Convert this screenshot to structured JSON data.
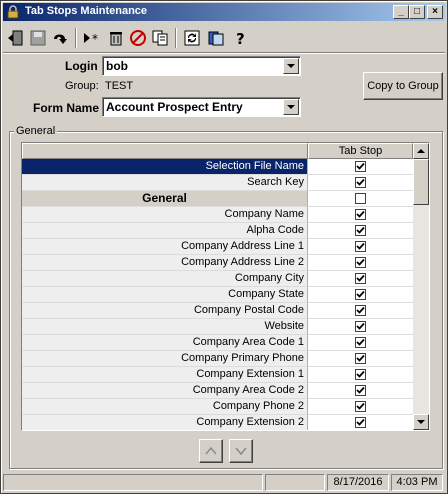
{
  "window": {
    "title": "Tab Stops Maintenance"
  },
  "toolbar": {
    "buttons": [
      {
        "name": "exit-icon"
      },
      {
        "name": "save-icon"
      },
      {
        "name": "undo-icon"
      },
      {
        "name": "new-record-icon"
      },
      {
        "name": "delete-icon"
      },
      {
        "name": "cancel-icon"
      },
      {
        "name": "copy-icon"
      },
      {
        "name": "refresh-icon"
      },
      {
        "name": "list-icon"
      },
      {
        "name": "help-icon"
      }
    ]
  },
  "form": {
    "login_label": "Login",
    "login_value": "bob",
    "group_label": "Group:",
    "group_value": "TEST",
    "form_name_label": "Form Name",
    "form_name_value": "Account Prospect Entry",
    "copy_button": "Copy to Group"
  },
  "general": {
    "group_label": "General",
    "column_header": "Tab Stop",
    "rows": [
      {
        "label": "Selection File Name",
        "checked": true,
        "selected": true,
        "section": false
      },
      {
        "label": "Search Key",
        "checked": true,
        "selected": false,
        "section": false
      },
      {
        "label": "General",
        "checked": false,
        "selected": false,
        "section": true
      },
      {
        "label": "Company Name",
        "checked": true,
        "selected": false,
        "section": false
      },
      {
        "label": "Alpha Code",
        "checked": true,
        "selected": false,
        "section": false
      },
      {
        "label": "Company Address Line 1",
        "checked": true,
        "selected": false,
        "section": false
      },
      {
        "label": "Company Address Line 2",
        "checked": true,
        "selected": false,
        "section": false
      },
      {
        "label": "Company City",
        "checked": true,
        "selected": false,
        "section": false
      },
      {
        "label": "Company State",
        "checked": true,
        "selected": false,
        "section": false
      },
      {
        "label": "Company Postal Code",
        "checked": true,
        "selected": false,
        "section": false
      },
      {
        "label": "Website",
        "checked": true,
        "selected": false,
        "section": false
      },
      {
        "label": "Company Area Code 1",
        "checked": true,
        "selected": false,
        "section": false
      },
      {
        "label": "Company Primary Phone",
        "checked": true,
        "selected": false,
        "section": false
      },
      {
        "label": "Company Extension 1",
        "checked": true,
        "selected": false,
        "section": false
      },
      {
        "label": "Company Area Code 2",
        "checked": true,
        "selected": false,
        "section": false
      },
      {
        "label": "Company Phone 2",
        "checked": true,
        "selected": false,
        "section": false
      },
      {
        "label": "Company Extension 2",
        "checked": true,
        "selected": false,
        "section": false
      }
    ]
  },
  "status": {
    "date": "8/17/2016",
    "time": "4:03 PM"
  }
}
